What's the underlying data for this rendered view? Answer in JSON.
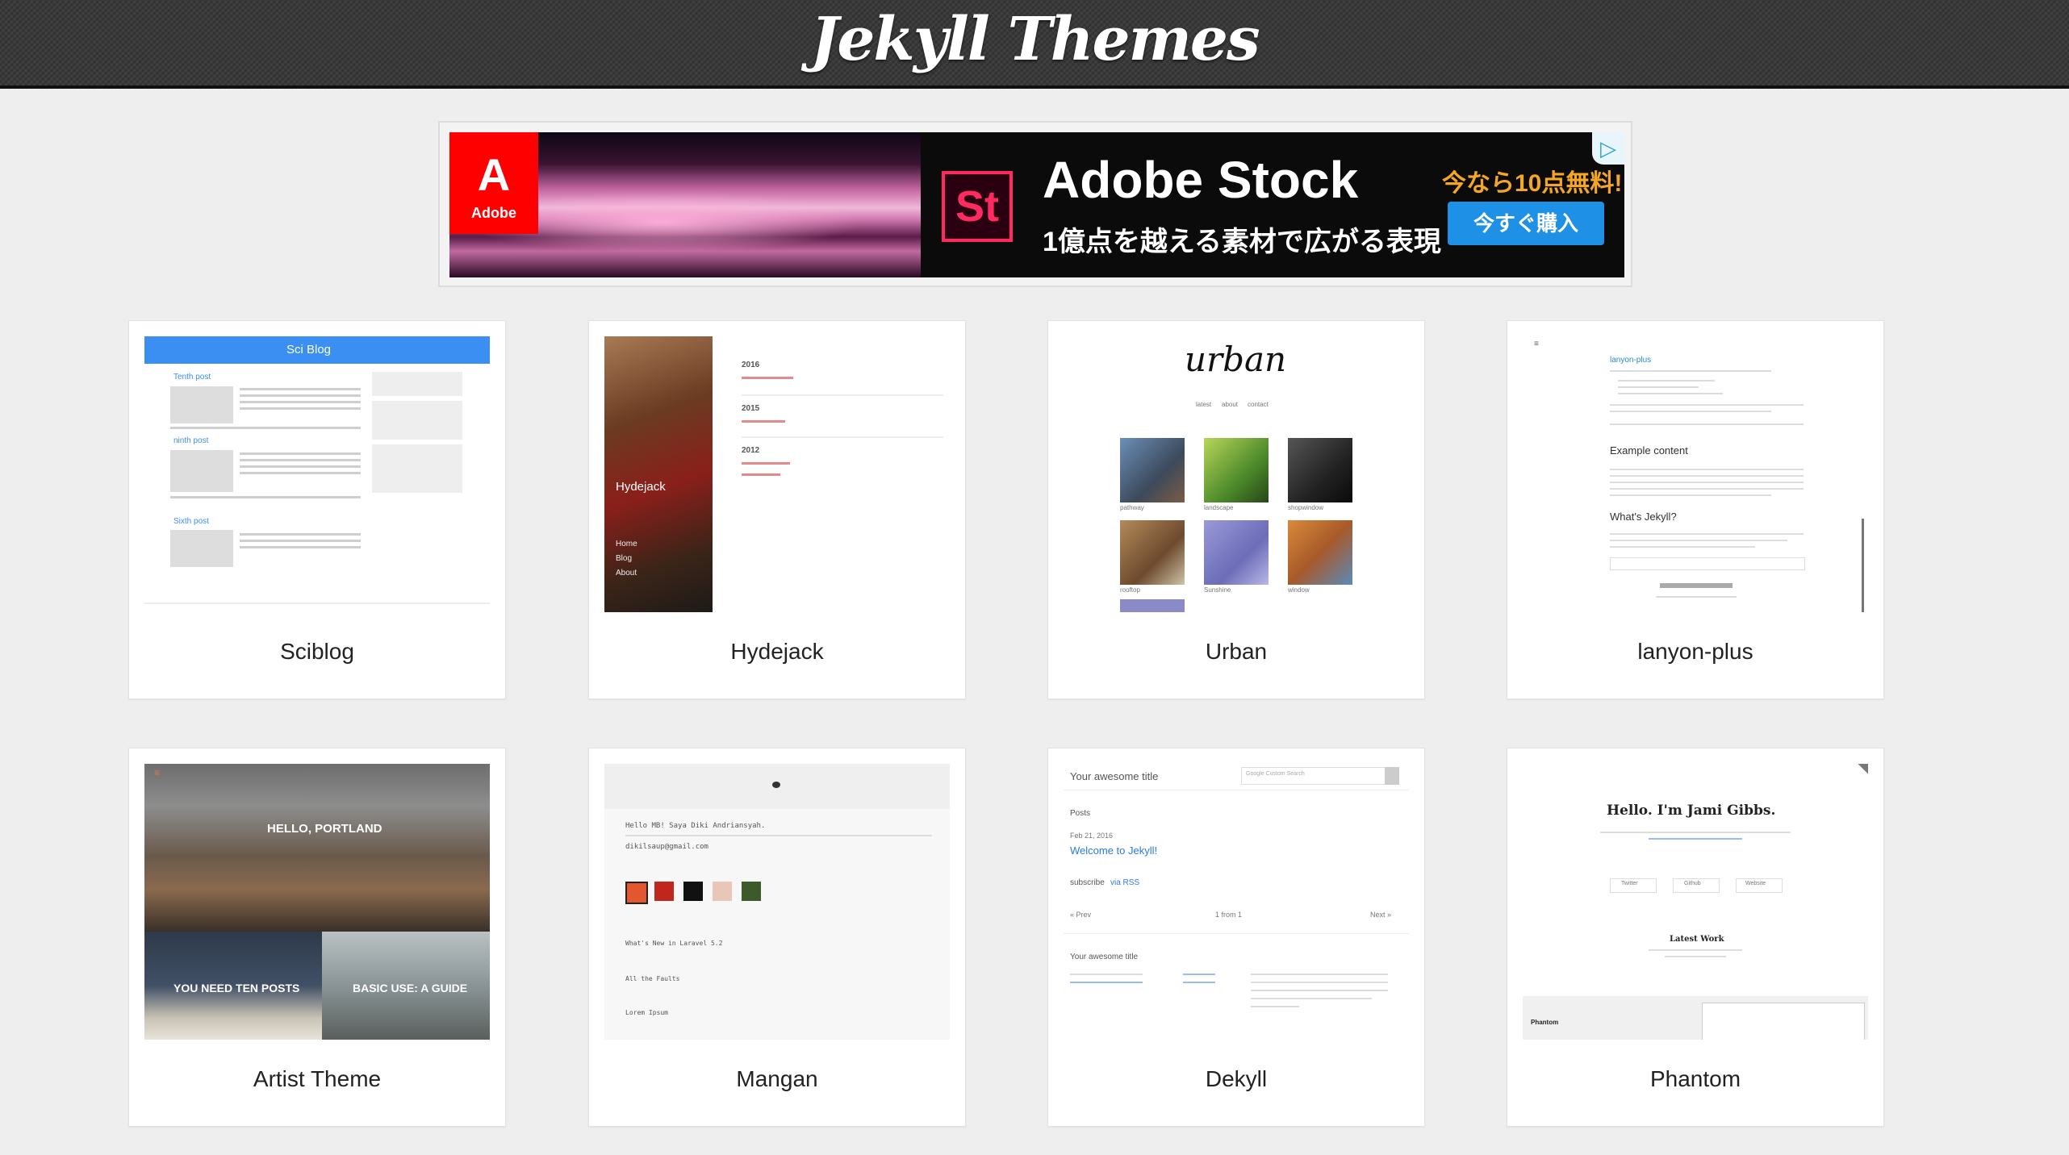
{
  "site": {
    "title": "Jekyll Themes"
  },
  "ad": {
    "brand": "Adobe",
    "adobe_mark": "A",
    "product_icon": "St",
    "headline": "Adobe Stock",
    "subline": "1億点を越える素材で広がる表現",
    "promo": "今なら10点無料!",
    "cta": "今すぐ購入",
    "choices_icon": "ad-choices-icon"
  },
  "themes": [
    {
      "name": "Sciblog",
      "preview": {
        "header": "Sci Blog",
        "posts": [
          "Tenth post",
          "ninth post",
          "Sixth post"
        ]
      }
    },
    {
      "name": "Hydejack",
      "preview": {
        "sidebar_title": "Hydejack",
        "years": [
          "2016",
          "2015",
          "2012"
        ],
        "nav": [
          "Home",
          "Blog",
          "About"
        ]
      }
    },
    {
      "name": "Urban",
      "preview": {
        "logo": "urban",
        "nav": [
          "latest",
          "about",
          "contact"
        ],
        "captions": [
          "pathway",
          "landscape",
          "shopwindow",
          "rooftop",
          "Sunshine",
          "window"
        ]
      }
    },
    {
      "name": "lanyon-plus",
      "preview": {
        "post_title": "lanyon-plus",
        "heading1": "Example content",
        "heading2": "What's Jekyll?"
      }
    },
    {
      "name": "Artist Theme",
      "preview": {
        "hero": "HELLO, PORTLAND",
        "tile1": "YOU NEED TEN POSTS",
        "tile2": "BASIC USE: A GUIDE"
      }
    },
    {
      "name": "Mangan",
      "preview": {
        "intro": "Hello MB! Saya Diki Andriansyah.",
        "email": "dikilsaup@gmail.com",
        "writings": [
          "What's New in Laravel 5.2",
          "All the Faults",
          "Lorem Ipsum"
        ]
      }
    },
    {
      "name": "Dekyll",
      "preview": {
        "site_title": "Your awesome title",
        "search_placeholder": "Google Custom Search",
        "posts_label": "Posts",
        "date": "Feb 21, 2016",
        "post": "Welcome to Jekyll!",
        "subscribe": "subscribe",
        "rss": "via RSS",
        "prev": "« Prev",
        "page": "1 from 1",
        "next": "Next »"
      }
    },
    {
      "name": "Phantom",
      "preview": {
        "greeting": "Hello. I'm Jami Gibbs.",
        "section": "Latest Work",
        "buttons": [
          "Twitter",
          "Github",
          "Website"
        ],
        "label": "Phantom"
      }
    }
  ]
}
